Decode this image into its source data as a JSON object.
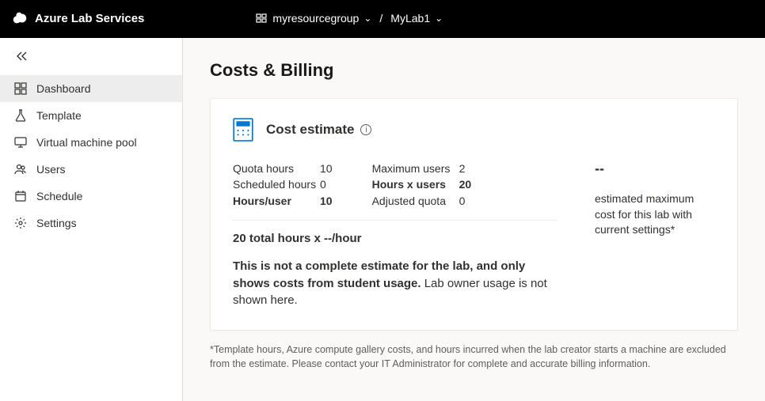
{
  "brand": "Azure Lab Services",
  "breadcrumb": {
    "resource_group": "myresourcegroup",
    "lab": "MyLab1",
    "separator": "/"
  },
  "sidebar": {
    "items": [
      {
        "label": "Dashboard",
        "icon": "dashboard"
      },
      {
        "label": "Template",
        "icon": "flask"
      },
      {
        "label": "Virtual machine pool",
        "icon": "monitor"
      },
      {
        "label": "Users",
        "icon": "users"
      },
      {
        "label": "Schedule",
        "icon": "calendar"
      },
      {
        "label": "Settings",
        "icon": "gear"
      }
    ]
  },
  "page_title": "Costs & Billing",
  "card": {
    "title": "Cost estimate",
    "metrics_left": {
      "quota_hours_label": "Quota hours",
      "quota_hours_value": "10",
      "scheduled_hours_label": "Scheduled hours",
      "scheduled_hours_value": "0",
      "hours_per_user_label": "Hours/user",
      "hours_per_user_value": "10"
    },
    "metrics_right": {
      "max_users_label": "Maximum users",
      "max_users_value": "2",
      "hours_x_users_label": "Hours x users",
      "hours_x_users_value": "20",
      "adjusted_quota_label": "Adjusted quota",
      "adjusted_quota_value": "0"
    },
    "estimate": {
      "value": "--",
      "caption": "estimated maximum cost for this lab with current settings*"
    },
    "totals_line": "20 total hours x --/hour",
    "disclaimer_bold": "This is not a complete estimate for the lab, and only shows costs from student usage.",
    "disclaimer_rest": " Lab owner usage is not shown here."
  },
  "footnote": "*Template hours, Azure compute gallery costs, and hours incurred when the lab creator starts a machine are excluded from the estimate. Please contact your IT Administrator for complete and accurate billing information."
}
